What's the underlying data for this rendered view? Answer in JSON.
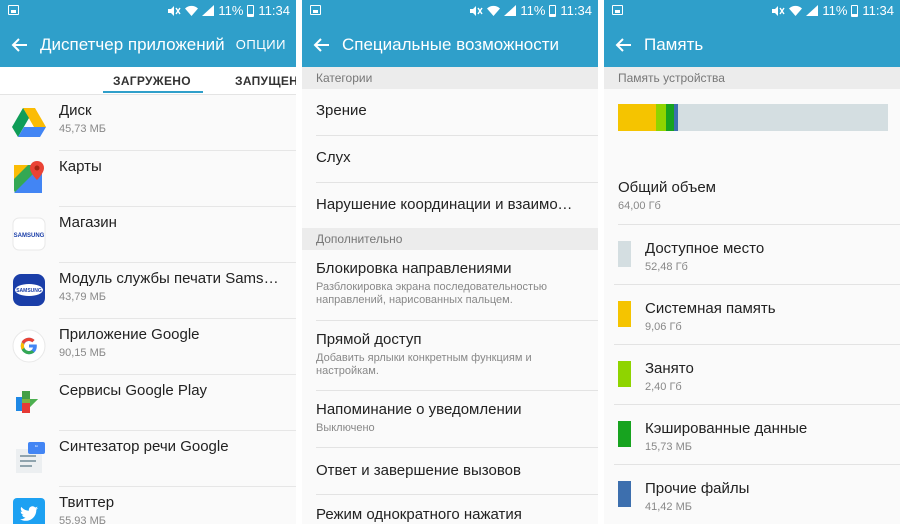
{
  "status_bar": {
    "battery": "11%",
    "time": "11:34"
  },
  "screen1": {
    "title": "Диспетчер приложений",
    "action": "ОПЦИИ",
    "tabs": [
      "ЗАГРУЖЕНО",
      "ЗАПУЩЕН"
    ],
    "apps": [
      {
        "name": "Диск",
        "size": "45,73 МБ",
        "icon": "google-drive-icon"
      },
      {
        "name": "Карты",
        "size": "",
        "icon": "google-maps-icon"
      },
      {
        "name": "Магазин",
        "size": "",
        "icon": "samsung-store-icon"
      },
      {
        "name": "Модуль службы печати Samsung",
        "size": "43,79 МБ",
        "icon": "samsung-print-icon"
      },
      {
        "name": "Приложение Google",
        "size": "90,15 МБ",
        "icon": "google-icon"
      },
      {
        "name": "Сервисы Google Play",
        "size": "",
        "icon": "google-play-services-icon"
      },
      {
        "name": "Синтезатор речи Google",
        "size": "",
        "icon": "google-tts-icon"
      },
      {
        "name": "Твиттер",
        "size": "55,93 МБ",
        "icon": "twitter-icon"
      }
    ]
  },
  "screen2": {
    "title": "Специальные возможности",
    "sections": [
      {
        "header": "Категории",
        "items": [
          {
            "label": "Зрение",
            "sub": ""
          },
          {
            "label": "Слух",
            "sub": ""
          },
          {
            "label": "Нарушение координации и взаимодействия",
            "sub": ""
          }
        ]
      },
      {
        "header": "Дополнительно",
        "items": [
          {
            "label": "Блокировка направлениями",
            "sub": "Разблокировка экрана последовательностью направлений, нарисованных пальцем."
          },
          {
            "label": "Прямой доступ",
            "sub": "Добавить ярлыки конкретным функциям и настройкам."
          },
          {
            "label": "Напоминание о уведомлении",
            "sub": "Выключено"
          },
          {
            "label": "Ответ и завершение вызовов",
            "sub": ""
          },
          {
            "label": "Режим однократного нажатия",
            "sub": ""
          }
        ]
      }
    ]
  },
  "screen3": {
    "title": "Память",
    "section": "Память устройства",
    "bar": [
      {
        "fraction": 0.141,
        "color": "#f5c400"
      },
      {
        "fraction": 0.038,
        "color": "#8fd400"
      },
      {
        "fraction": 0.03,
        "color": "#17a31f"
      },
      {
        "fraction": 0.015,
        "color": "#3d6fae"
      },
      {
        "fraction": 0.776,
        "color": "#d4dee1"
      }
    ],
    "total": {
      "label": "Общий объем",
      "value": "64,00 Гб"
    },
    "items": [
      {
        "label": "Доступное место",
        "value": "52,48 Гб",
        "color": "#d4dee1"
      },
      {
        "label": "Системная память",
        "value": "9,06 Гб",
        "color": "#f5c400"
      },
      {
        "label": "Занято",
        "value": "2,40 Гб",
        "color": "#8fd400"
      },
      {
        "label": "Кэшированные данные",
        "value": "15,73 МБ",
        "color": "#17a31f"
      },
      {
        "label": "Прочие файлы",
        "value": "41,42 МБ",
        "color": "#3d6fae"
      }
    ]
  }
}
